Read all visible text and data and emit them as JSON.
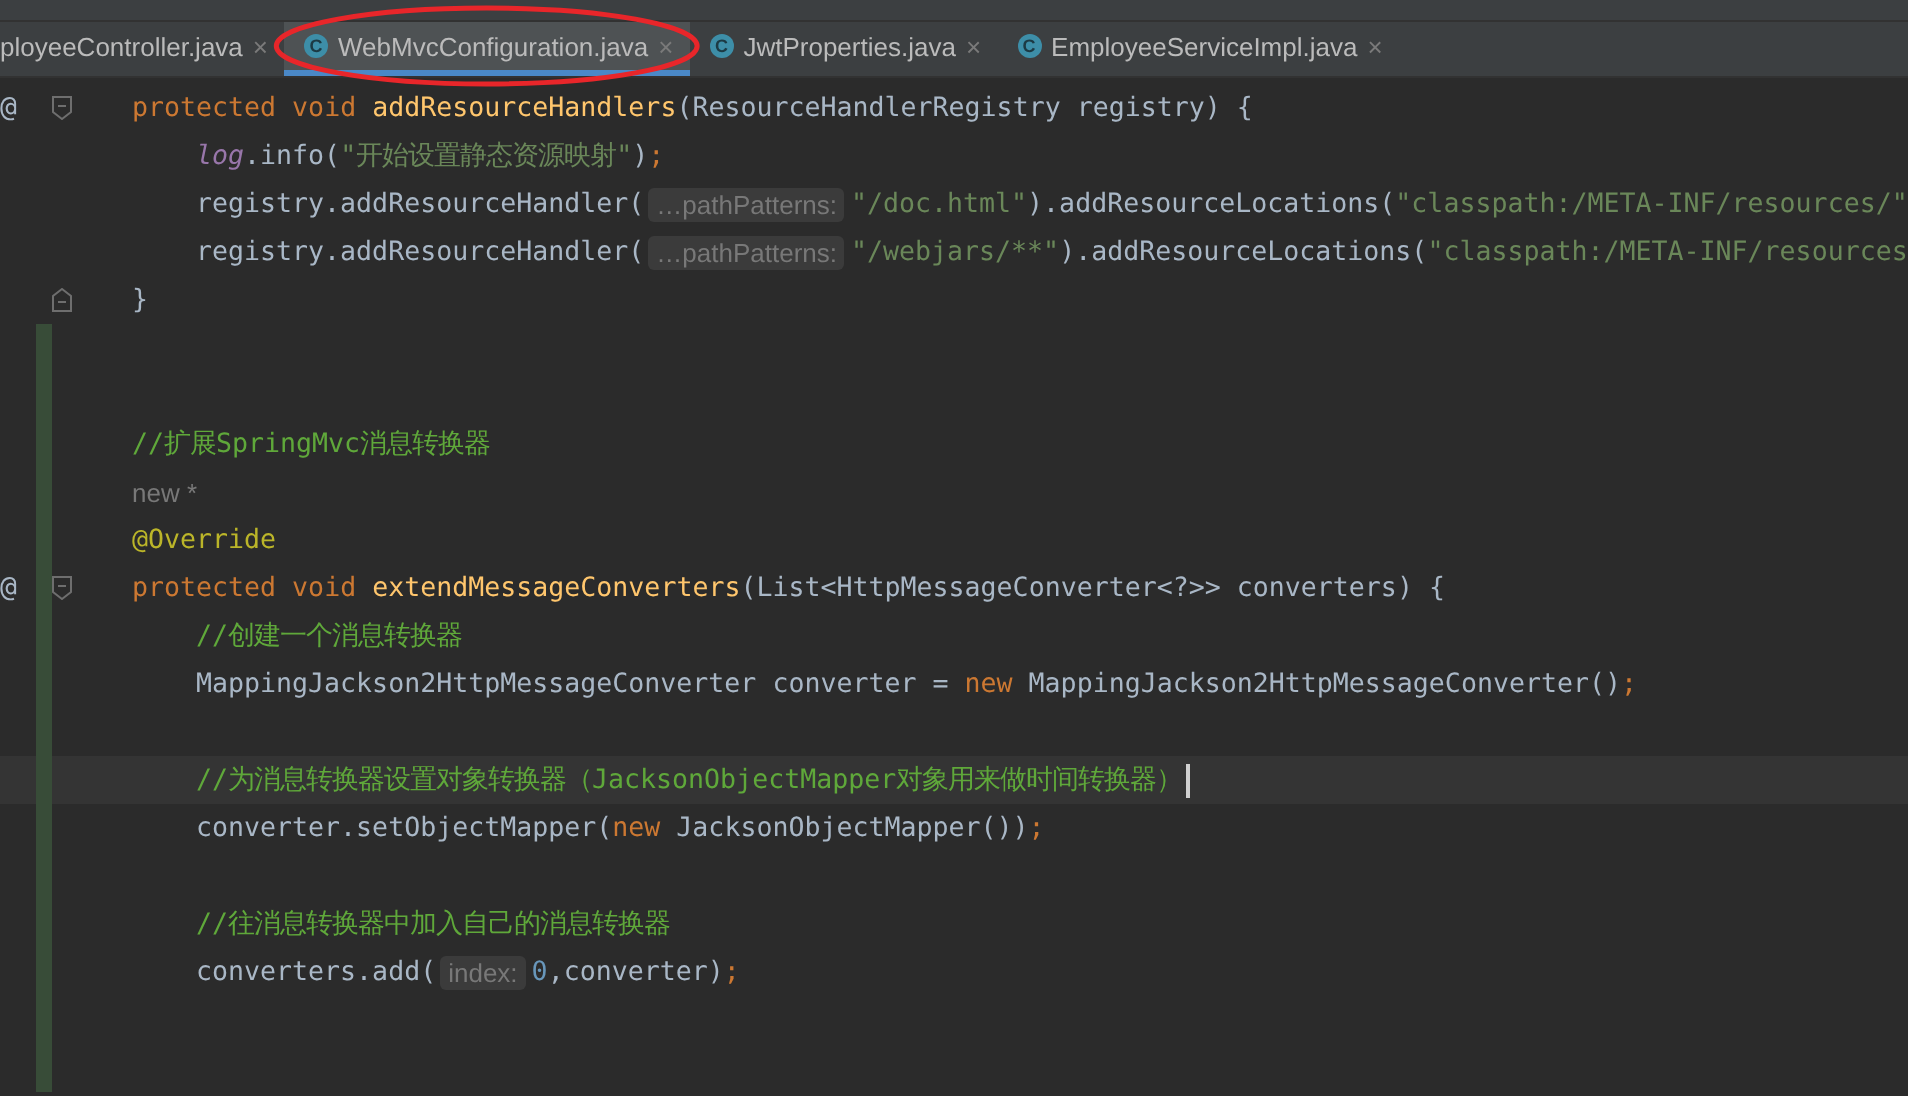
{
  "tabs": [
    {
      "label": "ployeeController.java",
      "close": "×",
      "selected": false,
      "circled": false
    },
    {
      "icon_letter": "C",
      "label": "WebMvcConfiguration.java",
      "close": "×",
      "selected": true,
      "circled": true
    },
    {
      "icon_letter": "C",
      "label": "JwtProperties.java",
      "close": "×",
      "selected": false,
      "circled": false
    },
    {
      "icon_letter": "C",
      "label": "EmployeeServiceImpl.java",
      "close": "×",
      "selected": false,
      "circled": false
    }
  ],
  "lines": [
    {
      "gutter_mark": "@",
      "fold": {
        "kind": "start"
      },
      "changed": false,
      "indented": false,
      "tokens": [
        {
          "text": "protected void ",
          "kind": "keyword"
        },
        {
          "text": "addResourceHandlers",
          "kind": "method"
        },
        {
          "text": "(ResourceHandlerRegistry registry) {",
          "kind": "plain"
        }
      ]
    },
    {
      "changed": false,
      "indented": true,
      "tokens": [
        {
          "text": "log",
          "kind": "field"
        },
        {
          "text": ".info(",
          "kind": "plain"
        },
        {
          "text": "\"开始设置静态资源映射\"",
          "kind": "string"
        },
        {
          "text": ")",
          "kind": "plain"
        },
        {
          "text": ";",
          "kind": "semicolon"
        }
      ]
    },
    {
      "changed": false,
      "indented": true,
      "tokens": [
        {
          "text": "registry.addResourceHandler(",
          "kind": "plain"
        },
        {
          "text": "…pathPatterns:",
          "kind": "hint"
        },
        {
          "text": "\"/doc.html\"",
          "kind": "string"
        },
        {
          "text": ").addResourceLocations(",
          "kind": "plain"
        },
        {
          "text": "\"classpath:/META-INF/resources/\"",
          "kind": "string"
        }
      ]
    },
    {
      "changed": false,
      "indented": true,
      "tokens": [
        {
          "text": "registry.addResourceHandler(",
          "kind": "plain"
        },
        {
          "text": "…pathPatterns:",
          "kind": "hint"
        },
        {
          "text": "\"/webjars/**\"",
          "kind": "string"
        },
        {
          "text": ").addResourceLocations(",
          "kind": "plain"
        },
        {
          "text": "\"classpath:/META-INF/resources",
          "kind": "string"
        }
      ]
    },
    {
      "fold": {
        "kind": "end"
      },
      "changed": false,
      "indented": false,
      "tokens": [
        {
          "text": "}",
          "kind": "plain"
        }
      ]
    },
    {
      "changed": true
    },
    {
      "changed": true
    },
    {
      "changed": true,
      "indented": false,
      "tokens": [
        {
          "text": "//扩展SpringMvc消息转换器",
          "kind": "comment"
        }
      ]
    },
    {
      "changed": true,
      "indented": false,
      "tokens": [
        {
          "text": "new *",
          "kind": "author"
        }
      ]
    },
    {
      "changed": true,
      "indented": false,
      "tokens": [
        {
          "text": "@Override",
          "kind": "annotation"
        }
      ]
    },
    {
      "gutter_mark": "@",
      "fold": {
        "kind": "start"
      },
      "changed": true,
      "indented": false,
      "tokens": [
        {
          "text": "protected void ",
          "kind": "keyword"
        },
        {
          "text": "extendMessageConverters",
          "kind": "method"
        },
        {
          "text": "(List<HttpMessageConverter<?>> converters) {",
          "kind": "plain"
        }
      ]
    },
    {
      "changed": true,
      "indented": true,
      "tokens": [
        {
          "text": "//创建一个消息转换器",
          "kind": "comment"
        }
      ]
    },
    {
      "changed": true,
      "indented": true,
      "tokens": [
        {
          "text": "MappingJackson2HttpMessageConverter converter = ",
          "kind": "plain"
        },
        {
          "text": "new ",
          "kind": "keyword"
        },
        {
          "text": "MappingJackson2HttpMessageConverter()",
          "kind": "plain"
        },
        {
          "text": ";",
          "kind": "semicolon"
        }
      ]
    },
    {
      "changed": true
    },
    {
      "changed": true,
      "current": true,
      "indented": true,
      "tokens": [
        {
          "text": "//为消息转换器设置对象转换器（JacksonObjectMapper对象用来做时间转换器）",
          "kind": "comment"
        }
      ]
    },
    {
      "changed": true,
      "indented": true,
      "tokens": [
        {
          "text": "converter.setObjectMapper(",
          "kind": "plain"
        },
        {
          "text": "new ",
          "kind": "keyword"
        },
        {
          "text": "JacksonObjectMapper())",
          "kind": "plain"
        },
        {
          "text": ";",
          "kind": "semicolon"
        }
      ]
    },
    {
      "changed": true
    },
    {
      "changed": true,
      "indented": true,
      "tokens": [
        {
          "text": "//往消息转换器中加入自己的消息转换器",
          "kind": "comment"
        }
      ]
    },
    {
      "changed": true,
      "indented": true,
      "tokens": [
        {
          "text": "converters.add(",
          "kind": "plain"
        },
        {
          "text": "index:",
          "kind": "hint"
        },
        {
          "text": "0",
          "kind": "number"
        },
        {
          "text": ",converter)",
          "kind": "plain"
        },
        {
          "text": ";",
          "kind": "semicolon"
        }
      ]
    },
    {
      "changed": true
    },
    {
      "changed": true
    }
  ]
}
